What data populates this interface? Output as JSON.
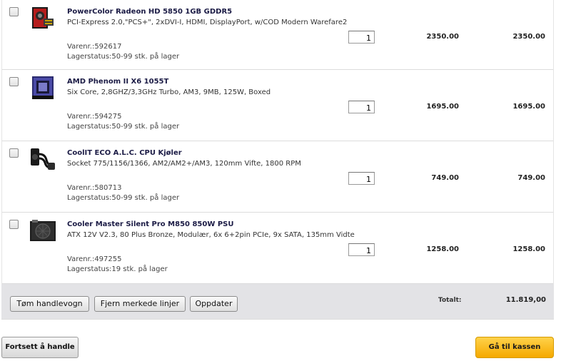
{
  "items": [
    {
      "name": "PowerColor Radeon HD 5850 1GB GDDR5",
      "description": "PCI-Express 2.0,\"PCS+\", 2xDVI-I, HDMI, DisplayPort, w/COD Modern Warefare2",
      "sku": "Varenr.:592617",
      "stock": "Lagerstatus:50-99 stk. på lager",
      "quantity": "1",
      "price": "2350.00",
      "total": "2350.00",
      "icon": "graphics-card-icon"
    },
    {
      "name": "AMD Phenom II X6 1055T",
      "description": "Six Core, 2,8GHZ/3,3GHz Turbo, AM3, 9MB, 125W, Boxed",
      "sku": "Varenr.:594275",
      "stock": "Lagerstatus:50-99 stk. på lager",
      "quantity": "1",
      "price": "1695.00",
      "total": "1695.00",
      "icon": "cpu-box-icon"
    },
    {
      "name": "CoolIT ECO A.L.C. CPU Kjøler",
      "description": "Socket 775/1156/1366, AM2/AM2+/AM3, 120mm Vifte, 1800 RPM",
      "sku": "Varenr.:580713",
      "stock": "Lagerstatus:50-99 stk. på lager",
      "quantity": "1",
      "price": "749.00",
      "total": "749.00",
      "icon": "cpu-cooler-icon"
    },
    {
      "name": "Cooler Master Silent Pro M850 850W PSU",
      "description": "ATX 12V V2.3, 80 Plus Bronze, Modulær, 6x 6+2pin PCIe, 9x SATA, 135mm Vidte",
      "sku": "Varenr.:497255",
      "stock": "Lagerstatus:19 stk. på lager",
      "quantity": "1",
      "price": "1258.00",
      "total": "1258.00",
      "icon": "power-supply-icon"
    }
  ],
  "footer": {
    "empty_cart": "Tøm handlevogn",
    "remove_selected": "Fjern merkede linjer",
    "update": "Oppdater",
    "total_label": "Totalt:",
    "total_value": "11.819,00"
  },
  "actions": {
    "continue_shopping": "Fortsett å handle",
    "checkout": "Gå til kassen"
  },
  "colors": {
    "checkout_bg": "#f5a900",
    "footer_bg": "#e3e3e6",
    "product_name": "#1b1b45"
  }
}
